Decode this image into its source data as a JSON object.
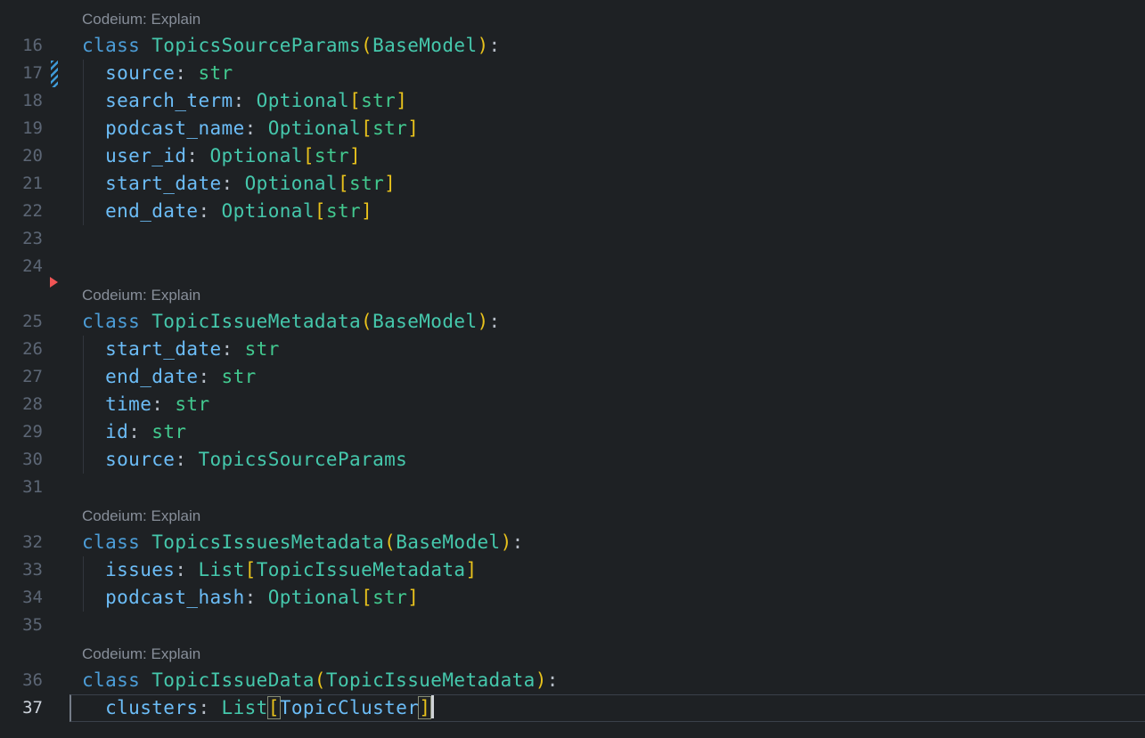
{
  "app": {
    "description": "dark code editor pane showing Python pydantic models",
    "codelens_label": "Codeium: Explain"
  },
  "colors": {
    "bg": "#1e2124",
    "codelens": "#878e99",
    "lineNumber": "#5c6675",
    "lineNumberActive": "#ced4dd",
    "kw": "#4c9dd7",
    "type": "#45c8ac",
    "btype": "#42c98f",
    "prop": "#6cbdf7",
    "pun": "#b5bcc6",
    "brk": "#e8c21c",
    "guide": "#32363d",
    "currentLineBorder": "#3a404a",
    "currentLineLeft": "#757d89",
    "bracketMatch": "#878d76",
    "cursor": "#d0d3d7",
    "modifiedMarker": "#3f9bd8",
    "arrowMarker": "#f05555"
  },
  "editor": {
    "rows": [
      {
        "type": "lens"
      },
      {
        "type": "code",
        "n": "16",
        "tokens": [
          {
            "t": "class ",
            "c": "kw"
          },
          {
            "t": "TopicsSourceParams",
            "c": "type"
          },
          {
            "t": "(",
            "c": "brk"
          },
          {
            "t": "BaseModel",
            "c": "type"
          },
          {
            "t": ")",
            "c": "brk"
          },
          {
            "t": ":",
            "c": "pun"
          }
        ]
      },
      {
        "type": "code",
        "n": "17",
        "guide": true,
        "gutterMarker": "modified",
        "tokens": [
          {
            "t": "  ",
            "c": "pun"
          },
          {
            "t": "source",
            "c": "prop"
          },
          {
            "t": ": ",
            "c": "pun"
          },
          {
            "t": "str",
            "c": "btype"
          }
        ]
      },
      {
        "type": "code",
        "n": "18",
        "guide": true,
        "tokens": [
          {
            "t": "  ",
            "c": "pun"
          },
          {
            "t": "search_term",
            "c": "prop"
          },
          {
            "t": ": ",
            "c": "pun"
          },
          {
            "t": "Optional",
            "c": "type"
          },
          {
            "t": "[",
            "c": "brk"
          },
          {
            "t": "str",
            "c": "btype"
          },
          {
            "t": "]",
            "c": "brk"
          }
        ]
      },
      {
        "type": "code",
        "n": "19",
        "guide": true,
        "tokens": [
          {
            "t": "  ",
            "c": "pun"
          },
          {
            "t": "podcast_name",
            "c": "prop"
          },
          {
            "t": ": ",
            "c": "pun"
          },
          {
            "t": "Optional",
            "c": "type"
          },
          {
            "t": "[",
            "c": "brk"
          },
          {
            "t": "str",
            "c": "btype"
          },
          {
            "t": "]",
            "c": "brk"
          }
        ]
      },
      {
        "type": "code",
        "n": "20",
        "guide": true,
        "tokens": [
          {
            "t": "  ",
            "c": "pun"
          },
          {
            "t": "user_id",
            "c": "prop"
          },
          {
            "t": ": ",
            "c": "pun"
          },
          {
            "t": "Optional",
            "c": "type"
          },
          {
            "t": "[",
            "c": "brk"
          },
          {
            "t": "str",
            "c": "btype"
          },
          {
            "t": "]",
            "c": "brk"
          }
        ]
      },
      {
        "type": "code",
        "n": "21",
        "guide": true,
        "tokens": [
          {
            "t": "  ",
            "c": "pun"
          },
          {
            "t": "start_date",
            "c": "prop"
          },
          {
            "t": ": ",
            "c": "pun"
          },
          {
            "t": "Optional",
            "c": "type"
          },
          {
            "t": "[",
            "c": "brk"
          },
          {
            "t": "str",
            "c": "btype"
          },
          {
            "t": "]",
            "c": "brk"
          }
        ]
      },
      {
        "type": "code",
        "n": "22",
        "guide": true,
        "tokens": [
          {
            "t": "  ",
            "c": "pun"
          },
          {
            "t": "end_date",
            "c": "prop"
          },
          {
            "t": ": ",
            "c": "pun"
          },
          {
            "t": "Optional",
            "c": "type"
          },
          {
            "t": "[",
            "c": "brk"
          },
          {
            "t": "str",
            "c": "btype"
          },
          {
            "t": "]",
            "c": "brk"
          }
        ]
      },
      {
        "type": "blank",
        "n": "23"
      },
      {
        "type": "blank",
        "n": "24",
        "gutterMarker": "arrow"
      },
      {
        "type": "lens"
      },
      {
        "type": "code",
        "n": "25",
        "tokens": [
          {
            "t": "class ",
            "c": "kw"
          },
          {
            "t": "TopicIssueMetadata",
            "c": "type"
          },
          {
            "t": "(",
            "c": "brk"
          },
          {
            "t": "BaseModel",
            "c": "type"
          },
          {
            "t": ")",
            "c": "brk"
          },
          {
            "t": ":",
            "c": "pun"
          }
        ]
      },
      {
        "type": "code",
        "n": "26",
        "guide": true,
        "tokens": [
          {
            "t": "  ",
            "c": "pun"
          },
          {
            "t": "start_date",
            "c": "prop"
          },
          {
            "t": ": ",
            "c": "pun"
          },
          {
            "t": "str",
            "c": "btype"
          }
        ]
      },
      {
        "type": "code",
        "n": "27",
        "guide": true,
        "tokens": [
          {
            "t": "  ",
            "c": "pun"
          },
          {
            "t": "end_date",
            "c": "prop"
          },
          {
            "t": ": ",
            "c": "pun"
          },
          {
            "t": "str",
            "c": "btype"
          }
        ]
      },
      {
        "type": "code",
        "n": "28",
        "guide": true,
        "tokens": [
          {
            "t": "  ",
            "c": "pun"
          },
          {
            "t": "time",
            "c": "prop"
          },
          {
            "t": ": ",
            "c": "pun"
          },
          {
            "t": "str",
            "c": "btype"
          }
        ]
      },
      {
        "type": "code",
        "n": "29",
        "guide": true,
        "tokens": [
          {
            "t": "  ",
            "c": "pun"
          },
          {
            "t": "id",
            "c": "prop"
          },
          {
            "t": ": ",
            "c": "pun"
          },
          {
            "t": "str",
            "c": "btype"
          }
        ]
      },
      {
        "type": "code",
        "n": "30",
        "guide": true,
        "tokens": [
          {
            "t": "  ",
            "c": "pun"
          },
          {
            "t": "source",
            "c": "prop"
          },
          {
            "t": ": ",
            "c": "pun"
          },
          {
            "t": "TopicsSourceParams",
            "c": "type"
          }
        ]
      },
      {
        "type": "blank",
        "n": "31"
      },
      {
        "type": "lens"
      },
      {
        "type": "code",
        "n": "32",
        "tokens": [
          {
            "t": "class ",
            "c": "kw"
          },
          {
            "t": "TopicsIssuesMetadata",
            "c": "type"
          },
          {
            "t": "(",
            "c": "brk"
          },
          {
            "t": "BaseModel",
            "c": "type"
          },
          {
            "t": ")",
            "c": "brk"
          },
          {
            "t": ":",
            "c": "pun"
          }
        ]
      },
      {
        "type": "code",
        "n": "33",
        "guide": true,
        "tokens": [
          {
            "t": "  ",
            "c": "pun"
          },
          {
            "t": "issues",
            "c": "prop"
          },
          {
            "t": ": ",
            "c": "pun"
          },
          {
            "t": "List",
            "c": "type"
          },
          {
            "t": "[",
            "c": "brk"
          },
          {
            "t": "TopicIssueMetadata",
            "c": "type"
          },
          {
            "t": "]",
            "c": "brk"
          }
        ]
      },
      {
        "type": "code",
        "n": "34",
        "guide": true,
        "tokens": [
          {
            "t": "  ",
            "c": "pun"
          },
          {
            "t": "podcast_hash",
            "c": "prop"
          },
          {
            "t": ": ",
            "c": "pun"
          },
          {
            "t": "Optional",
            "c": "type"
          },
          {
            "t": "[",
            "c": "brk"
          },
          {
            "t": "str",
            "c": "btype"
          },
          {
            "t": "]",
            "c": "brk"
          }
        ]
      },
      {
        "type": "blank",
        "n": "35"
      },
      {
        "type": "lens"
      },
      {
        "type": "code",
        "n": "36",
        "tokens": [
          {
            "t": "class ",
            "c": "kw"
          },
          {
            "t": "TopicIssueData",
            "c": "type"
          },
          {
            "t": "(",
            "c": "brk"
          },
          {
            "t": "TopicIssueMetadata",
            "c": "type"
          },
          {
            "t": ")",
            "c": "brk"
          },
          {
            "t": ":",
            "c": "pun"
          }
        ]
      },
      {
        "type": "code",
        "n": "37",
        "current": true,
        "cursor": true,
        "tokens": [
          {
            "t": "  ",
            "c": "pun"
          },
          {
            "t": "clusters",
            "c": "prop"
          },
          {
            "t": ": ",
            "c": "pun"
          },
          {
            "t": "List",
            "c": "type"
          },
          {
            "t": "[",
            "c": "brk",
            "m": true
          },
          {
            "t": "TopicCluster",
            "c": "prop"
          },
          {
            "t": "]",
            "c": "brk",
            "m": true
          }
        ]
      }
    ]
  }
}
